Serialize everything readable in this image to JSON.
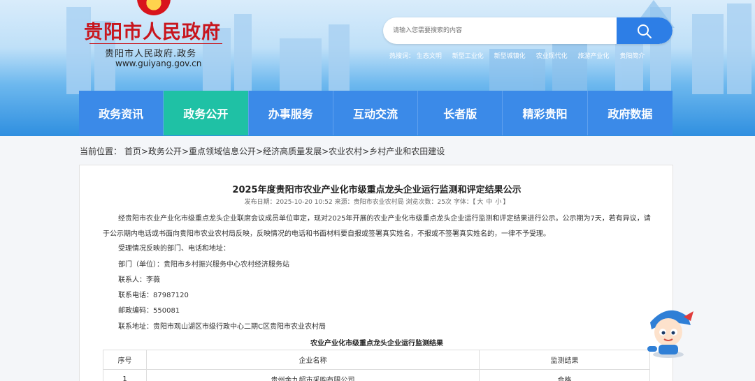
{
  "header": {
    "title": "贵阳市人民政府",
    "subtitle": "贵阳市人民政府.政务",
    "url": "www.guiyang.gov.cn"
  },
  "search": {
    "placeholder": "请输入您需要搜索的内容"
  },
  "hotwords": {
    "label": "热搜词：",
    "items": [
      "生态文明",
      "新型工业化",
      "新型城镇化",
      "农业现代化",
      "旅游产业化",
      "贵阳简介"
    ]
  },
  "nav": {
    "items": [
      "政务资讯",
      "政务公开",
      "办事服务",
      "互动交流",
      "长者版",
      "精彩贵阳",
      "政府数据"
    ],
    "active_index": 1
  },
  "breadcrumb": {
    "label": "当前位置：",
    "items": [
      "首页",
      "政务公开",
      "重点领域信息公开",
      "经济高质量发展",
      "农业农村",
      "乡村产业和农田建设"
    ],
    "separator": ">"
  },
  "article": {
    "title": "2025年度贵阳市农业产业化市级重点龙头企业运行监测和评定结果公示",
    "meta": {
      "publish": "发布日期：2025-10-20 10:52",
      "source": "来源：贵阳市农业农村局",
      "views": "浏览次数：25次",
      "font_label": "字体：【",
      "font_big": "大",
      "font_mid": "中",
      "font_small": "小",
      "font_end": "】"
    },
    "para1": "经贵阳市农业产业化市级重点龙头企业联席会议成员单位审定，现对2025年开展的农业产业化市级重点龙头企业运行监测和评定结果进行公示。公示期为7天，若有异议，请于公示期内电话或书面向贵阳市农业农村局反映，反映情况的电话和书面材料要自报或签署真实姓名，不报或不签署真实姓名的，一律不予受理。",
    "intro": "受理情况反映的部门、电话和地址：",
    "dept": "部门（单位）：贵阳市乡村振兴服务中心农村经济服务站",
    "contact": "联系人：李薇",
    "phone": "联系电话：87987120",
    "postcode": "邮政编码：550081",
    "address": "联系地址：贵阳市观山湖区市级行政中心二期C区贵阳市农业农村局",
    "table_title": "农业产业化市级重点龙头企业运行监测结果",
    "table_headers": [
      "序号",
      "企业名称",
      "监测结果"
    ],
    "table_rows": [
      [
        "1",
        "贵州金九超市采购有限公司",
        "合格"
      ]
    ]
  },
  "colors": {
    "nav_bg": "#3b8ae8",
    "nav_active": "#1fc1a5",
    "title_red": "#c8151d",
    "search_btn": "#2d7ee6"
  }
}
